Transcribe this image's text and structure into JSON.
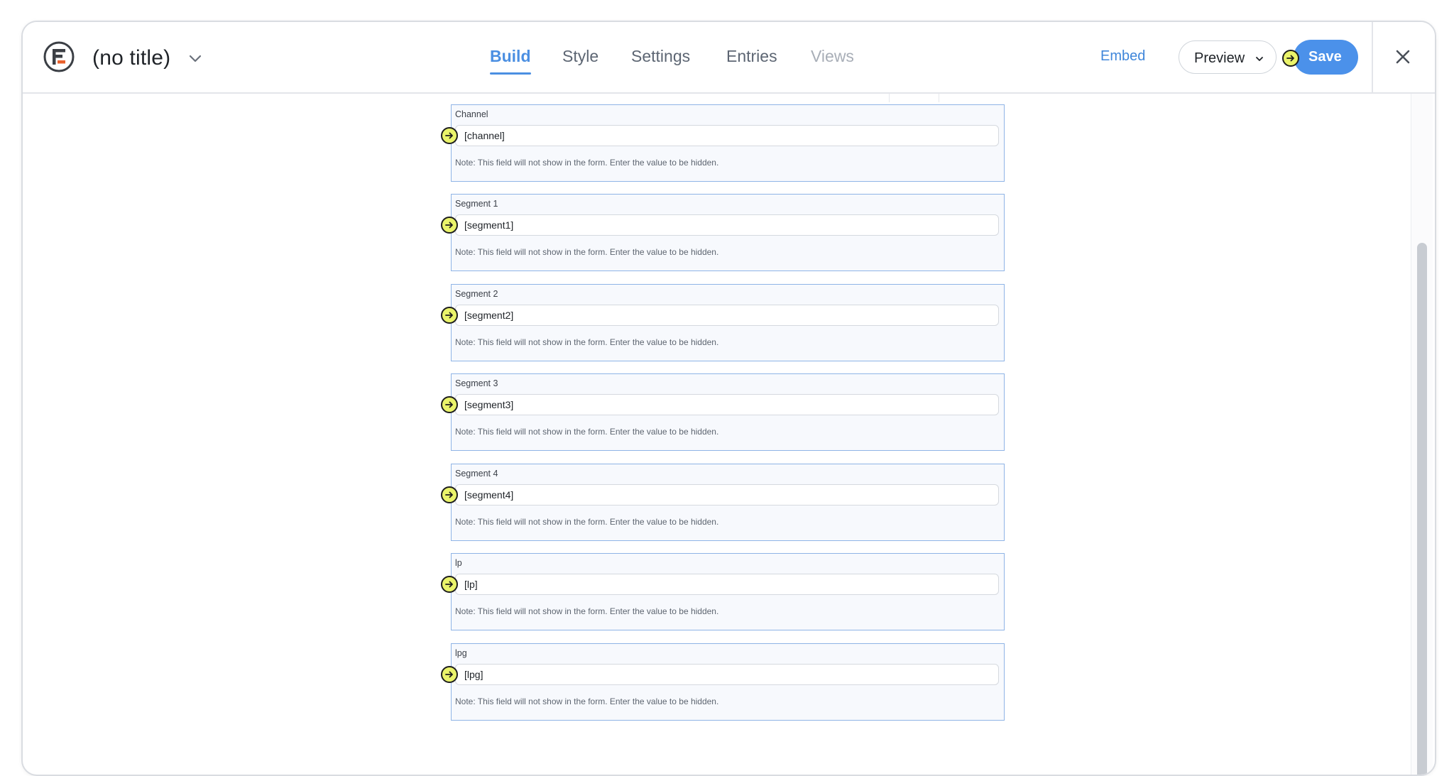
{
  "header": {
    "form_title": "(no title)",
    "tabs": [
      {
        "label": "Build",
        "state": "active"
      },
      {
        "label": "Style",
        "state": "normal"
      },
      {
        "label": "Settings",
        "state": "normal"
      },
      {
        "label": "Entries",
        "state": "normal"
      },
      {
        "label": "Views",
        "state": "disabled"
      }
    ],
    "embed_label": "Embed",
    "preview_label": "Preview",
    "save_label": "Save"
  },
  "fields": [
    {
      "label": "Channel",
      "value": "[channel]",
      "note": "Note: This field will not show in the form. Enter the value to be hidden."
    },
    {
      "label": "Segment 1",
      "value": "[segment1]",
      "note": "Note: This field will not show in the form. Enter the value to be hidden."
    },
    {
      "label": "Segment 2",
      "value": "[segment2]",
      "note": "Note: This field will not show in the form. Enter the value to be hidden."
    },
    {
      "label": "Segment 3",
      "value": "[segment3]",
      "note": "Note: This field will not show in the form. Enter the value to be hidden."
    },
    {
      "label": "Segment 4",
      "value": "[segment4]",
      "note": "Note: This field will not show in the form. Enter the value to be hidden."
    },
    {
      "label": "lp",
      "value": "[lp]",
      "note": "Note: This field will not show in the form. Enter the value to be hidden."
    },
    {
      "label": "lpg",
      "value": "[lpg]",
      "note": "Note: This field will not show in the form. Enter the value to be hidden."
    }
  ],
  "colors": {
    "accent": "#4b8fe2",
    "save_button": "#4b91ea",
    "field_border": "#8fb4e6",
    "marker": "#eaf36a"
  },
  "icons": {
    "logo": "formidable-logo-icon",
    "title_dropdown": "chevron-down-icon",
    "preview_dropdown": "chevron-down-icon",
    "close": "close-icon",
    "marker": "arrow-right-circle-icon"
  }
}
